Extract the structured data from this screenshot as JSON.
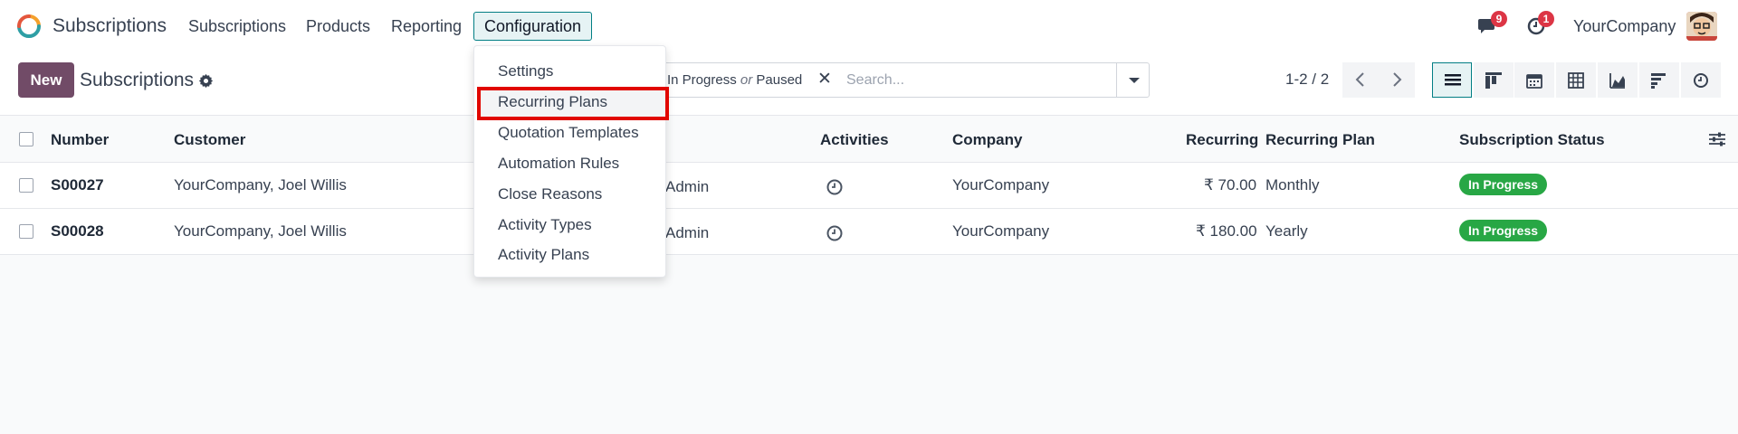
{
  "app": {
    "name": "Subscriptions"
  },
  "nav": {
    "items": [
      "Subscriptions",
      "Products",
      "Reporting"
    ],
    "active": "Configuration"
  },
  "systray": {
    "messages_count": "9",
    "activities_count": "1",
    "company": "YourCompany"
  },
  "control": {
    "new_label": "New",
    "title": "Subscriptions",
    "facet_in_progress": "In Progress",
    "facet_or": "or",
    "facet_paused": "Paused",
    "facet_remove": "✕",
    "search_placeholder": "Search...",
    "pager": "1-2 / 2"
  },
  "table": {
    "headers": {
      "number": "Number",
      "customer": "Customer",
      "activities": "Activities",
      "company": "Company",
      "recurring": "Recurring",
      "recurring_plan": "Recurring Plan",
      "status": "Subscription Status"
    },
    "rows": [
      {
        "number": "S00027",
        "customer": "YourCompany, Joel Willis",
        "salesperson": "Admin",
        "company": "YourCompany",
        "recurring": "₹ 70.00",
        "plan": "Monthly",
        "status": "In Progress"
      },
      {
        "number": "S00028",
        "customer": "YourCompany, Joel Willis",
        "salesperson": "Admin",
        "company": "YourCompany",
        "recurring": "₹ 180.00",
        "plan": "Yearly",
        "status": "In Progress"
      }
    ]
  },
  "dropdown": {
    "items": [
      "Settings",
      "Recurring Plans",
      "Quotation Templates",
      "Automation Rules",
      "Close Reasons",
      "Activity Types",
      "Activity Plans"
    ],
    "highlighted": "Recurring Plans"
  },
  "colors": {
    "brand": "#714b67",
    "accent": "#017e84",
    "status_in_progress": "#28a745",
    "badge": "#dc3545",
    "highlight_border": "#e10600"
  }
}
